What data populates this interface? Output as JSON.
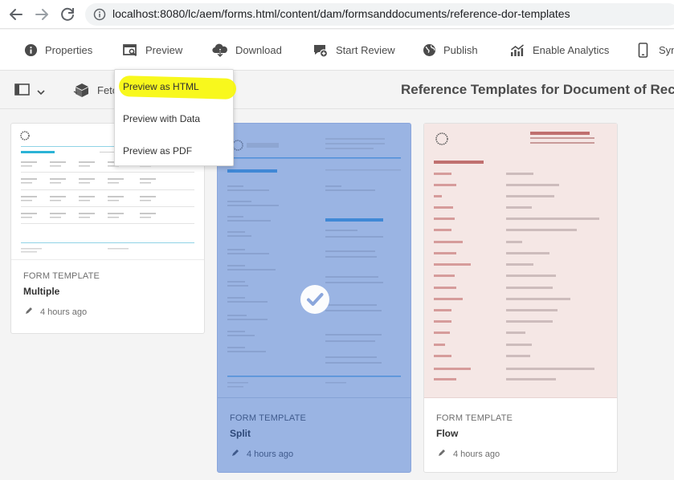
{
  "browser": {
    "url": "localhost:8080/lc/aem/forms.html/content/dam/formsanddocuments/reference-dor-templates"
  },
  "toolbar": {
    "items": [
      {
        "label": "Properties",
        "icon": "info-icon"
      },
      {
        "label": "Preview",
        "icon": "preview-icon"
      },
      {
        "label": "Download",
        "icon": "download-icon"
      },
      {
        "label": "Start Review",
        "icon": "review-icon"
      },
      {
        "label": "Publish",
        "icon": "globe-icon"
      },
      {
        "label": "Enable Analytics",
        "icon": "analytics-icon"
      },
      {
        "label": "Syn",
        "icon": "mobile-icon"
      }
    ]
  },
  "subbar": {
    "fetch_label": "Fetc",
    "page_title": "Reference Templates for Document of Record"
  },
  "preview_menu": {
    "items": [
      "Preview as HTML",
      "Preview with Data",
      "Preview as PDF"
    ],
    "highlighted": "Preview as HTML",
    "highlight_color": "#f7f70a"
  },
  "cards": [
    {
      "kind": "FORM TEMPLATE",
      "name": "Multiple",
      "time": "4 hours ago",
      "selected": false
    },
    {
      "kind": "FORM TEMPLATE",
      "name": "Split",
      "time": "4 hours ago",
      "selected": true
    },
    {
      "kind": "FORM TEMPLATE",
      "name": "Flow",
      "time": "4 hours ago",
      "selected": false
    }
  ],
  "colors": {
    "accent_cyan": "#2bb3d6",
    "selection_blue": "#9ab4e3",
    "flow_red": "#c0706f"
  }
}
